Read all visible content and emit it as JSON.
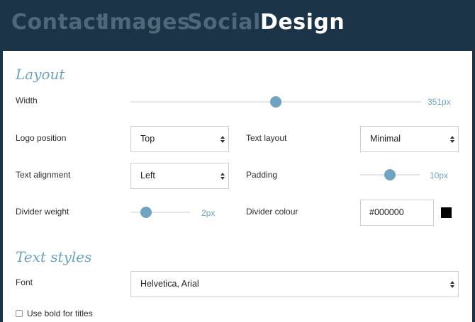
{
  "tabs": [
    {
      "label": "Contact"
    },
    {
      "label": "Images"
    },
    {
      "label": "Social"
    },
    {
      "label": "Design"
    }
  ],
  "active_tab": "Design",
  "layout": {
    "title": "Layout",
    "width": {
      "label": "Width",
      "value_text": "351px",
      "fraction": 0.5
    },
    "logo_position": {
      "label": "Logo position",
      "value": "Top"
    },
    "text_layout": {
      "label": "Text layout",
      "value": "Minimal"
    },
    "text_alignment": {
      "label": "Text alignment",
      "value": "Left"
    },
    "padding": {
      "label": "Padding",
      "value_text": "10px",
      "fraction": 0.5
    },
    "divider_weight": {
      "label": "Divider weight",
      "value_text": "2px",
      "fraction": 0.25
    },
    "divider_colour": {
      "label": "Divider colour",
      "value": "#000000",
      "swatch_color": "#000000"
    }
  },
  "text_styles": {
    "title": "Text styles",
    "font": {
      "label": "Font",
      "value": "Helvetica, Arial"
    },
    "bold_titles": {
      "label": "Use bold for titles",
      "checked": false
    }
  },
  "colors": {
    "header_bg": "#1b3448",
    "accent": "#6fa4c0",
    "inactive_tab": "#4f6777"
  }
}
